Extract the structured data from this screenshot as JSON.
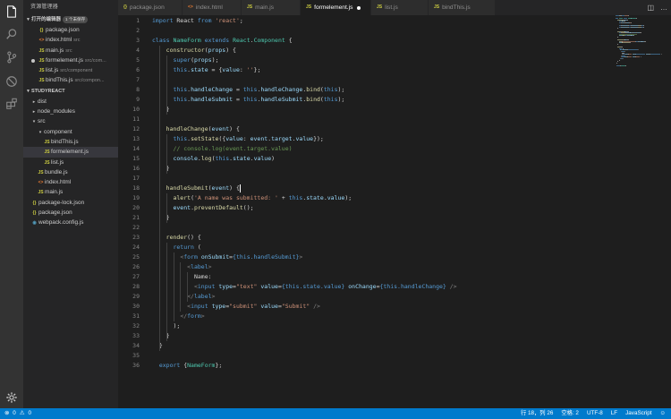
{
  "sidebar": {
    "title": "资源管理器",
    "open_editors": {
      "label": "打开的编辑器",
      "badge": "1 个未保存"
    },
    "open_files": [
      {
        "name": "package.json",
        "hint": "",
        "icon": "json",
        "dirty": false
      },
      {
        "name": "index.html",
        "hint": "src",
        "icon": "html",
        "dirty": false
      },
      {
        "name": "main.js",
        "hint": "src",
        "icon": "js",
        "dirty": false
      },
      {
        "name": "formelement.js",
        "hint": "src/com...",
        "icon": "js",
        "dirty": true
      },
      {
        "name": "list.js",
        "hint": "src/component",
        "icon": "js",
        "dirty": false
      },
      {
        "name": "bindThis.js",
        "hint": "src/compon...",
        "icon": "js",
        "dirty": false
      }
    ],
    "project": {
      "label": "STUDYREACT"
    },
    "tree": [
      {
        "name": "dist",
        "kind": "folder",
        "open": false,
        "depth": 0
      },
      {
        "name": "node_modules",
        "kind": "folder",
        "open": false,
        "depth": 0
      },
      {
        "name": "src",
        "kind": "folder",
        "open": true,
        "depth": 0
      },
      {
        "name": "component",
        "kind": "folder",
        "open": true,
        "depth": 1
      },
      {
        "name": "bindThis.js",
        "kind": "js",
        "depth": 2
      },
      {
        "name": "formelement.js",
        "kind": "js",
        "depth": 2,
        "selected": true
      },
      {
        "name": "list.js",
        "kind": "js",
        "depth": 2
      },
      {
        "name": "bundle.js",
        "kind": "js",
        "depth": 1
      },
      {
        "name": "index.html",
        "kind": "html",
        "depth": 1
      },
      {
        "name": "main.js",
        "kind": "js",
        "depth": 1
      },
      {
        "name": "package-lock.json",
        "kind": "json",
        "depth": 0
      },
      {
        "name": "package.json",
        "kind": "json",
        "depth": 0
      },
      {
        "name": "webpack.config.js",
        "kind": "cfg",
        "depth": 0
      }
    ]
  },
  "tabs": [
    {
      "name": "package.json",
      "icon": "json",
      "active": false,
      "dirty": false
    },
    {
      "name": "index.html",
      "icon": "html",
      "active": false,
      "dirty": false
    },
    {
      "name": "main.js",
      "icon": "js",
      "active": false,
      "dirty": false
    },
    {
      "name": "formelement.js",
      "icon": "js",
      "active": true,
      "dirty": true
    },
    {
      "name": "list.js",
      "icon": "js",
      "active": false,
      "dirty": false
    },
    {
      "name": "bindThis.js",
      "icon": "js",
      "active": false,
      "dirty": false
    }
  ],
  "editor": {
    "cursor_line": 18,
    "lines": [
      [
        [
          "k",
          "import"
        ],
        [
          "t",
          " React "
        ],
        [
          "k",
          "from"
        ],
        [
          "t",
          " "
        ],
        [
          "s",
          "'react'"
        ],
        [
          "t",
          ";"
        ]
      ],
      [],
      [
        [
          "k",
          "class"
        ],
        [
          "t",
          " "
        ],
        [
          "c",
          "NameForm"
        ],
        [
          "t",
          " "
        ],
        [
          "k",
          "extends"
        ],
        [
          "t",
          " "
        ],
        [
          "c",
          "React"
        ],
        [
          "t",
          "."
        ],
        [
          "c",
          "Component"
        ],
        [
          "t",
          " {"
        ]
      ],
      [
        [
          "t",
          "    "
        ],
        [
          "f",
          "constructor"
        ],
        [
          "t",
          "("
        ],
        [
          "v",
          "props"
        ],
        [
          "t",
          ") {"
        ]
      ],
      [
        [
          "t",
          "      "
        ],
        [
          "k",
          "super"
        ],
        [
          "t",
          "("
        ],
        [
          "v",
          "props"
        ],
        [
          "t",
          ");"
        ]
      ],
      [
        [
          "t",
          "      "
        ],
        [
          "k",
          "this"
        ],
        [
          "t",
          "."
        ],
        [
          "v",
          "state"
        ],
        [
          "t",
          " = {"
        ],
        [
          "v",
          "value"
        ],
        [
          "t",
          ": "
        ],
        [
          "s",
          "''"
        ],
        [
          "t",
          "};"
        ]
      ],
      [],
      [
        [
          "t",
          "      "
        ],
        [
          "k",
          "this"
        ],
        [
          "t",
          "."
        ],
        [
          "v",
          "handleChange"
        ],
        [
          "t",
          " = "
        ],
        [
          "k",
          "this"
        ],
        [
          "t",
          "."
        ],
        [
          "v",
          "handleChange"
        ],
        [
          "t",
          "."
        ],
        [
          "f",
          "bind"
        ],
        [
          "t",
          "("
        ],
        [
          "k",
          "this"
        ],
        [
          "t",
          ");"
        ]
      ],
      [
        [
          "t",
          "      "
        ],
        [
          "k",
          "this"
        ],
        [
          "t",
          "."
        ],
        [
          "v",
          "handleSubmit"
        ],
        [
          "t",
          " = "
        ],
        [
          "k",
          "this"
        ],
        [
          "t",
          "."
        ],
        [
          "v",
          "handleSubmit"
        ],
        [
          "t",
          "."
        ],
        [
          "f",
          "bind"
        ],
        [
          "t",
          "("
        ],
        [
          "k",
          "this"
        ],
        [
          "t",
          ");"
        ]
      ],
      [
        [
          "t",
          "    }"
        ]
      ],
      [],
      [
        [
          "t",
          "    "
        ],
        [
          "f",
          "handleChange"
        ],
        [
          "t",
          "("
        ],
        [
          "v",
          "event"
        ],
        [
          "t",
          ") {"
        ]
      ],
      [
        [
          "t",
          "      "
        ],
        [
          "k",
          "this"
        ],
        [
          "t",
          "."
        ],
        [
          "f",
          "setState"
        ],
        [
          "t",
          "({"
        ],
        [
          "v",
          "value"
        ],
        [
          "t",
          ": "
        ],
        [
          "v",
          "event"
        ],
        [
          "t",
          "."
        ],
        [
          "v",
          "target"
        ],
        [
          "t",
          "."
        ],
        [
          "v",
          "value"
        ],
        [
          "t",
          "});"
        ]
      ],
      [
        [
          "t",
          "      "
        ],
        [
          "m",
          "// console.log(event.target.value)"
        ]
      ],
      [
        [
          "t",
          "      "
        ],
        [
          "v",
          "console"
        ],
        [
          "t",
          "."
        ],
        [
          "f",
          "log"
        ],
        [
          "t",
          "("
        ],
        [
          "k",
          "this"
        ],
        [
          "t",
          "."
        ],
        [
          "v",
          "state"
        ],
        [
          "t",
          "."
        ],
        [
          "v",
          "value"
        ],
        [
          "t",
          ")"
        ]
      ],
      [
        [
          "t",
          "    }"
        ]
      ],
      [],
      [
        [
          "t",
          "    "
        ],
        [
          "f",
          "handleSubmit"
        ],
        [
          "t",
          "("
        ],
        [
          "v",
          "event"
        ],
        [
          "t",
          ") {"
        ]
      ],
      [
        [
          "t",
          "      "
        ],
        [
          "f",
          "alert"
        ],
        [
          "t",
          "("
        ],
        [
          "s",
          "'A name was submitted: '"
        ],
        [
          "t",
          " + "
        ],
        [
          "k",
          "this"
        ],
        [
          "t",
          "."
        ],
        [
          "v",
          "state"
        ],
        [
          "t",
          "."
        ],
        [
          "v",
          "value"
        ],
        [
          "t",
          ");"
        ]
      ],
      [
        [
          "t",
          "      "
        ],
        [
          "v",
          "event"
        ],
        [
          "t",
          "."
        ],
        [
          "f",
          "preventDefault"
        ],
        [
          "t",
          "();"
        ]
      ],
      [
        [
          "t",
          "    }"
        ]
      ],
      [],
      [
        [
          "t",
          "    "
        ],
        [
          "f",
          "render"
        ],
        [
          "t",
          "() {"
        ]
      ],
      [
        [
          "t",
          "      "
        ],
        [
          "k",
          "return"
        ],
        [
          "t",
          " ("
        ]
      ],
      [
        [
          "t",
          "        "
        ],
        [
          "g",
          "<"
        ],
        [
          "h",
          "form"
        ],
        [
          "t",
          " "
        ],
        [
          "a",
          "onSubmit"
        ],
        [
          "t",
          "="
        ],
        [
          "x",
          "{this.handleSubmit}"
        ],
        [
          "g",
          ">"
        ]
      ],
      [
        [
          "t",
          "          "
        ],
        [
          "g",
          "<"
        ],
        [
          "h",
          "label"
        ],
        [
          "g",
          ">"
        ]
      ],
      [
        [
          "t",
          "            Name:"
        ]
      ],
      [
        [
          "t",
          "            "
        ],
        [
          "g",
          "<"
        ],
        [
          "h",
          "input"
        ],
        [
          "t",
          " "
        ],
        [
          "a",
          "type"
        ],
        [
          "t",
          "="
        ],
        [
          "s",
          "\"text\""
        ],
        [
          "t",
          " "
        ],
        [
          "a",
          "value"
        ],
        [
          "t",
          "="
        ],
        [
          "x",
          "{this.state.value}"
        ],
        [
          "t",
          " "
        ],
        [
          "a",
          "onChange"
        ],
        [
          "t",
          "="
        ],
        [
          "x",
          "{this.handleChange}"
        ],
        [
          "t",
          " "
        ],
        [
          "g",
          "/>"
        ]
      ],
      [
        [
          "t",
          "          "
        ],
        [
          "g",
          "</"
        ],
        [
          "h",
          "label"
        ],
        [
          "g",
          ">"
        ]
      ],
      [
        [
          "t",
          "          "
        ],
        [
          "g",
          "<"
        ],
        [
          "h",
          "input"
        ],
        [
          "t",
          " "
        ],
        [
          "a",
          "type"
        ],
        [
          "t",
          "="
        ],
        [
          "s",
          "\"submit\""
        ],
        [
          "t",
          " "
        ],
        [
          "a",
          "value"
        ],
        [
          "t",
          "="
        ],
        [
          "s",
          "\"Submit\""
        ],
        [
          "t",
          " "
        ],
        [
          "g",
          "/>"
        ]
      ],
      [
        [
          "t",
          "        "
        ],
        [
          "g",
          "</"
        ],
        [
          "h",
          "form"
        ],
        [
          "g",
          ">"
        ]
      ],
      [
        [
          "t",
          "      );"
        ]
      ],
      [
        [
          "t",
          "    }"
        ]
      ],
      [
        [
          "t",
          "  }"
        ]
      ],
      [],
      [
        [
          "t",
          "  "
        ],
        [
          "k",
          "export"
        ],
        [
          "t",
          " {"
        ],
        [
          "c",
          "NameForm"
        ],
        [
          "t",
          "};"
        ]
      ]
    ]
  },
  "status": {
    "errors": "0",
    "warnings": "0",
    "position": "行 18，列 26",
    "indent": "空格: 2",
    "encoding": "UTF-8",
    "eol": "LF",
    "language": "JavaScript"
  },
  "colors": {
    "k": "#569cd6",
    "t": "#d4d4d4",
    "s": "#ce9178",
    "c": "#4ec9b0",
    "f": "#dcdcaa",
    "v": "#9cdcfe",
    "m": "#6a9955",
    "g": "#808080",
    "h": "#569cd6",
    "a": "#9cdcfe",
    "x": "#569cd6",
    "statusbar": "#007acc"
  }
}
